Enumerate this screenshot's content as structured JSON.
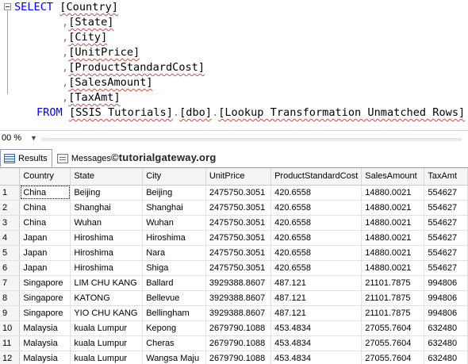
{
  "query": {
    "select_keyword": "SELECT",
    "from_keyword": "FROM",
    "columns": [
      "[Country]",
      "[State]",
      "[City]",
      "[UnitPrice]",
      "[ProductStandardCost]",
      "[SalesAmount]",
      "[TaxAmt]"
    ],
    "comma": ",",
    "source": {
      "database": "[SSIS Tutorials]",
      "schema": "[dbo]",
      "table": "[Lookup Transformation Unmatched Rows]",
      "dot": "."
    }
  },
  "zoom": {
    "value": "00 %"
  },
  "tabs": {
    "results": "Results",
    "messages": "Messages"
  },
  "watermark": "©tutorialgateway.org",
  "grid": {
    "columns": [
      "Country",
      "State",
      "City",
      "UnitPrice",
      "ProductStandardCost",
      "SalesAmount",
      "TaxAmt"
    ],
    "rows": [
      [
        "1",
        "China",
        "Beijing",
        "Beijing",
        "2475750.3051",
        "420.6558",
        "14880.0021",
        "554627"
      ],
      [
        "2",
        "China",
        "Shanghai",
        "Shanghai",
        "2475750.3051",
        "420.6558",
        "14880.0021",
        "554627"
      ],
      [
        "3",
        "China",
        "Wuhan",
        "Wuhan",
        "2475750.3051",
        "420.6558",
        "14880.0021",
        "554627"
      ],
      [
        "4",
        "Japan",
        "Hiroshima",
        "Hiroshima",
        "2475750.3051",
        "420.6558",
        "14880.0021",
        "554627"
      ],
      [
        "5",
        "Japan",
        "Hiroshima",
        "Nara",
        "2475750.3051",
        "420.6558",
        "14880.0021",
        "554627"
      ],
      [
        "6",
        "Japan",
        "Hiroshima",
        "Shiga",
        "2475750.3051",
        "420.6558",
        "14880.0021",
        "554627"
      ],
      [
        "7",
        "Singapore",
        "LIM CHU KANG",
        "Ballard",
        "3929388.8607",
        "487.121",
        "21101.7875",
        "994806"
      ],
      [
        "8",
        "Singapore",
        "KATONG",
        "Bellevue",
        "3929388.8607",
        "487.121",
        "21101.7875",
        "994806"
      ],
      [
        "9",
        "Singapore",
        "YIO CHU KANG",
        "Bellingham",
        "3929388.8607",
        "487.121",
        "21101.7875",
        "994806"
      ],
      [
        "10",
        "Malaysia",
        "kuala Lumpur",
        "Kepong",
        "2679790.1088",
        "453.4834",
        "27055.7604",
        "632480"
      ],
      [
        "11",
        "Malaysia",
        "kuala Lumpur",
        "Cheras",
        "2679790.1088",
        "453.4834",
        "27055.7604",
        "632480"
      ],
      [
        "12",
        "Malaysia",
        "kuala Lumpur",
        "Wangsa Maju",
        "2679790.1088",
        "453.4834",
        "27055.7604",
        "632480"
      ]
    ]
  }
}
